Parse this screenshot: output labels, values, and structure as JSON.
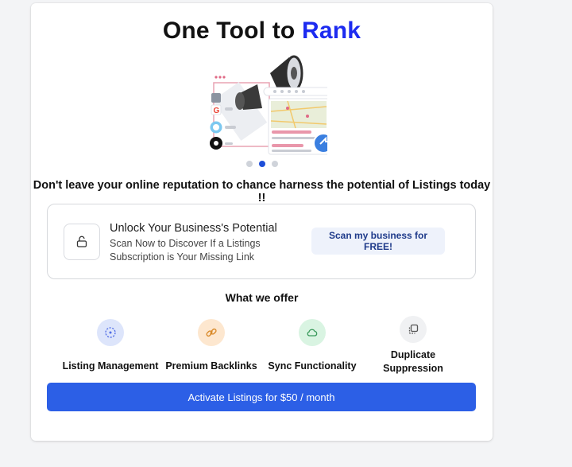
{
  "header": {
    "title_main": "One Tool to",
    "title_accent": "Rank"
  },
  "carousel": {
    "total": 3,
    "active_index": 1
  },
  "tagline": "Don't leave your online reputation to chance harness the potential of Listings today !!",
  "unlock": {
    "heading": "Unlock Your Business's Potential",
    "description": "Scan Now to Discover If a Listings Subscription is Your Missing Link",
    "scan_label": "Scan my business for FREE!"
  },
  "offer": {
    "heading": "What we offer",
    "features": [
      {
        "label": "Listing Management",
        "icon": "target-icon",
        "bg": "#dde5fb",
        "fg": "#4f6ce6"
      },
      {
        "label": "Premium Backlinks",
        "icon": "link-icon",
        "bg": "#fde7cf",
        "fg": "#d98a2a"
      },
      {
        "label": "Sync Functionality",
        "icon": "cloud-icon",
        "bg": "#d9f4e2",
        "fg": "#3a9a5c"
      },
      {
        "label": "Duplicate Suppression",
        "icon": "copy-icon",
        "bg": "#f0f1f3",
        "fg": "#555"
      }
    ]
  },
  "activate": {
    "label": "Activate Listings for $50 / month"
  },
  "colors": {
    "accent": "#1d2bf0",
    "primary_button": "#2c5fe6"
  }
}
